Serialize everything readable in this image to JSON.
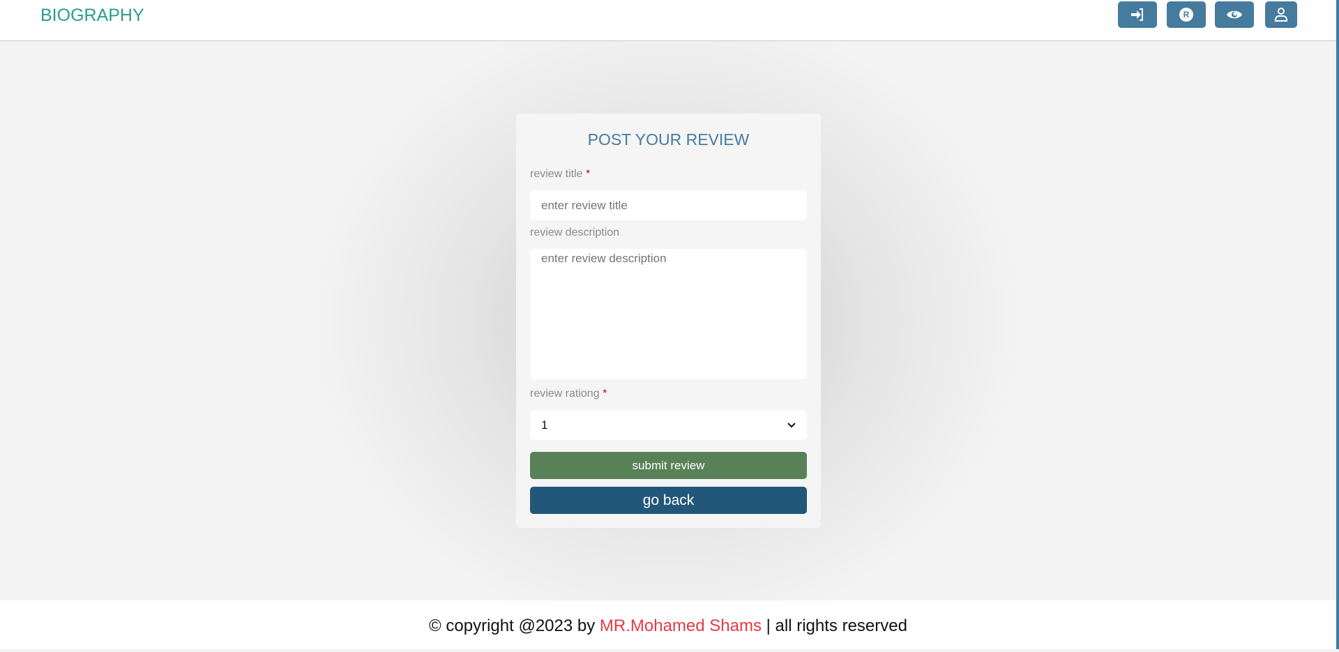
{
  "header": {
    "brand": "BIOGRAPHY",
    "buttons": [
      {
        "icon": "login-icon"
      },
      {
        "icon": "register-icon",
        "glyph": "R"
      },
      {
        "icon": "eye-icon"
      },
      {
        "icon": "user-icon"
      }
    ]
  },
  "form": {
    "title": "POST YOUR REVIEW",
    "title_label": "review title",
    "title_placeholder": "enter review title",
    "description_label": "review description",
    "description_placeholder": "enter review description",
    "rating_label": "review rationg",
    "rating_value": "1",
    "required_mark": "*",
    "submit_label": "submit review",
    "back_label": "go back"
  },
  "footer": {
    "prefix": "© copyright @2023 by ",
    "author": "MR.Mohamed Shams",
    "suffix": " | all rights reserved"
  },
  "colors": {
    "brand": "#2a9d8f",
    "primary": "#457b9d",
    "submit": "#588157",
    "back": "#225779",
    "accent": "#e63946"
  }
}
